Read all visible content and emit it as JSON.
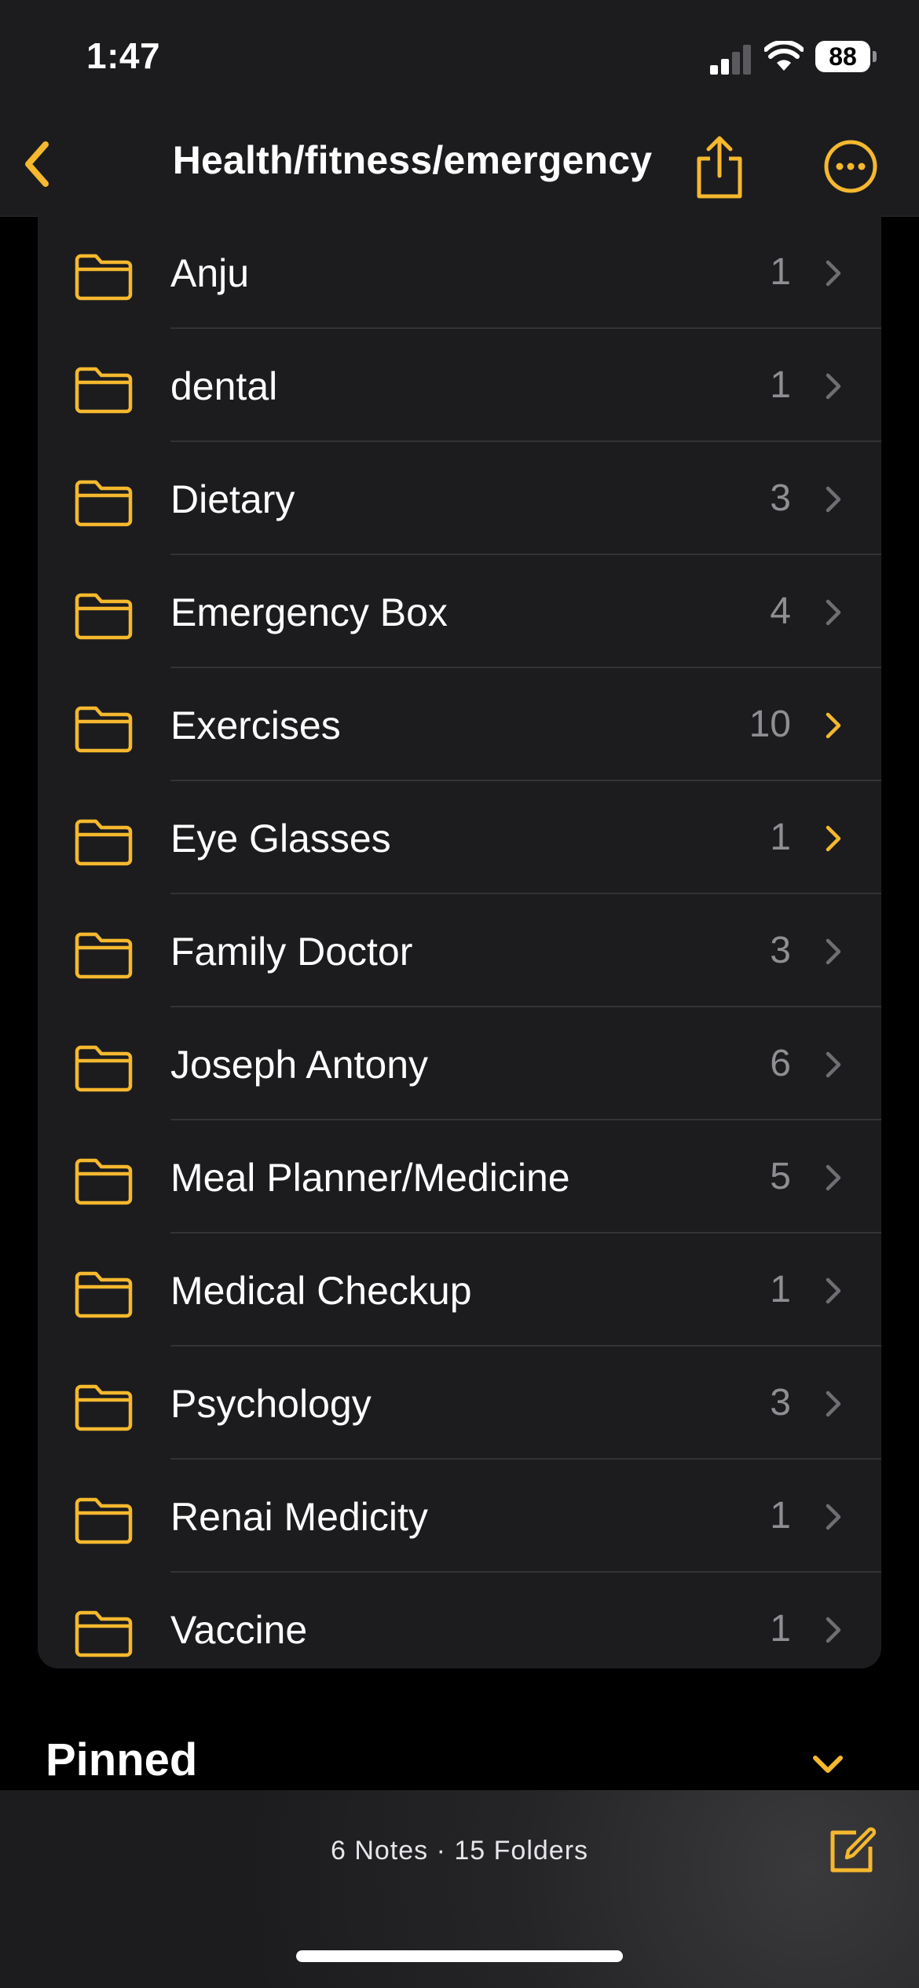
{
  "status_bar": {
    "time": "1:47",
    "battery": "88"
  },
  "nav": {
    "title": "Health/fitness/emergency",
    "accent": "#f5b82e"
  },
  "folders": [
    {
      "name": "Anju",
      "count": "1"
    },
    {
      "name": "dental",
      "count": "1"
    },
    {
      "name": "Dietary",
      "count": "3"
    },
    {
      "name": "Emergency Box",
      "count": "4"
    },
    {
      "name": "Exercises",
      "count": "10"
    },
    {
      "name": "Eye Glasses",
      "count": "1"
    },
    {
      "name": "Family Doctor",
      "count": "3"
    },
    {
      "name": "Joseph Antony",
      "count": "6"
    },
    {
      "name": "Meal Planner/Medicine",
      "count": "5"
    },
    {
      "name": "Medical Checkup",
      "count": "1"
    },
    {
      "name": "Psychology",
      "count": "3"
    },
    {
      "name": "Renai Medicity",
      "count": "1"
    },
    {
      "name": "Vaccine",
      "count": "1"
    }
  ],
  "sections": {
    "pinned": "Pinned"
  },
  "bottom_bar": {
    "summary": "6 Notes · 15 Folders"
  },
  "icons": {
    "back": "chevron-left-icon",
    "share": "share-icon",
    "more": "ellipsis-circle-icon",
    "folder": "folder-icon",
    "row": "chevron-right-icon",
    "compose": "compose-icon"
  }
}
